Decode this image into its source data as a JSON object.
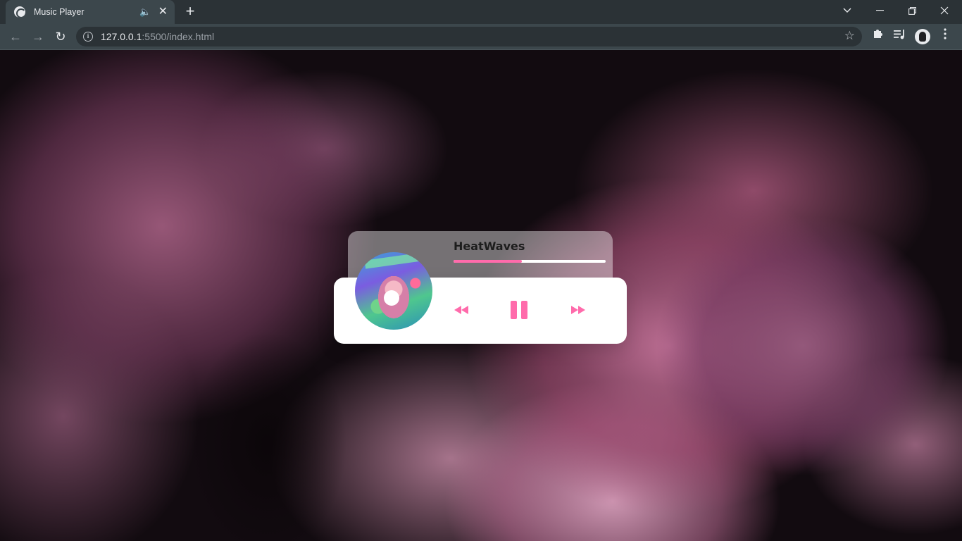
{
  "browser": {
    "tab_title": "Music Player",
    "new_tab_label": "+",
    "url_host": "127.0.0.1",
    "url_rest": ":5500/index.html",
    "tab_search_icon": "chevron-down-icon",
    "minimize_icon": "minimize-icon",
    "restore_icon": "restore-icon",
    "close_icon": "close-icon"
  },
  "player": {
    "song_title": "HeatWaves",
    "progress": 0.45,
    "state": "playing",
    "accent_color": "#ff6bab"
  }
}
